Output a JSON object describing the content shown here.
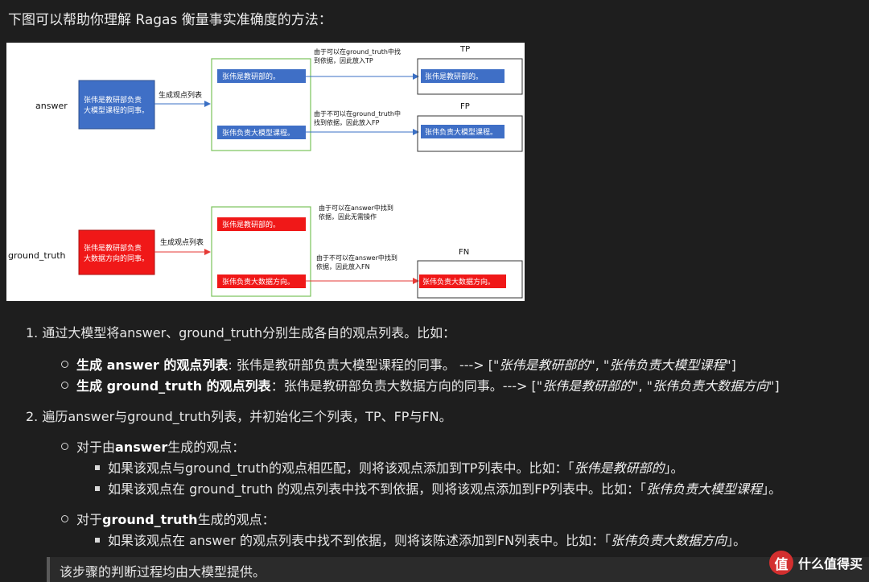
{
  "intro": "下图可以帮助你理解 Ragas 衡量事实准确度的方法：",
  "diagram": {
    "answer_label": "answer",
    "gt_label": "ground_truth",
    "answer_box": [
      "张伟是教研部负责",
      "大模型课程的同事。"
    ],
    "gt_box": [
      "张伟是教研部负责",
      "大数据方向的同事。"
    ],
    "gen_label_top": "生成观点列表",
    "gen_label_bottom": "生成观点列表",
    "a_claim1": "张伟是教研部的。",
    "a_claim2": "张伟负责大模型课程。",
    "g_claim1": "张伟是教研部的。",
    "g_claim2": "张伟负责大数据方向。",
    "note_tp": [
      "由于可以在ground_truth中找",
      "到依据，因此放入TP"
    ],
    "note_fp": [
      "由于不可以在ground_truth中",
      "找到依据，因此放入FP"
    ],
    "note_none": [
      "由于可以在answer中找到",
      "依据，因此无需操作"
    ],
    "note_fn": [
      "由于不可以在answer中找到",
      "依据，因此放入FN"
    ],
    "tp_label": "TP",
    "fp_label": "FP",
    "fn_label": "FN",
    "tp_item": "张伟是教研部的。",
    "fp_item": "张伟负责大模型课程。",
    "fn_item": "张伟负责大数据方向。"
  },
  "step1": {
    "num": "1.",
    "text": "通过大模型将answer、ground_truth分别生成各自的观点列表。比如：",
    "a_bold": "生成 answer 的观点列表",
    "a_text": ": 张伟是教研部负责大模型课程的同事。 ---> [\"",
    "a_i1": "张伟是教研部的",
    "a_sep": "\", \"",
    "a_i2": "张伟负责大模型课程",
    "a_end": "\"]",
    "g_bold": "生成 ground_truth 的观点列表",
    "g_text": "：张伟是教研部负责大数据方向的同事。---> [\"",
    "g_i1": "张伟是教研部的",
    "g_sep": "\", \"",
    "g_i2": "张伟负责大数据方向",
    "g_end": "\"]"
  },
  "step2": {
    "num": "2.",
    "text": "遍历answer与ground_truth列表，并初始化三个列表，TP、FP与FN。",
    "sub1_pre": "对于由",
    "sub1_bold": "answer",
    "sub1_post": "生成的观点：",
    "sub1_item1_text": "如果该观点与ground_truth的观点相匹配，则将该观点添加到TP列表中。比如：「",
    "sub1_item1_i": "张伟是教研部的",
    "sub1_item1_end": "」。",
    "sub1_item2_text": "如果该观点在 ground_truth 的观点列表中找不到依据，则将该观点添加到FP列表中。比如：「",
    "sub1_item2_i": "张伟负责大模型课程",
    "sub1_item2_end": "」。",
    "sub2_pre": "对于",
    "sub2_bold": "ground_truth",
    "sub2_post": "生成的观点：",
    "sub2_item1_text": "如果该观点在 answer 的观点列表中找不到依据，则将该陈述添加到FN列表中。比如：「",
    "sub2_item1_i": "张伟负责大数据方向",
    "sub2_item1_end": "」。"
  },
  "quote": "该步骤的判断过程均由大模型提供。",
  "watermark": {
    "icon": "值",
    "text": "什么值得买"
  }
}
